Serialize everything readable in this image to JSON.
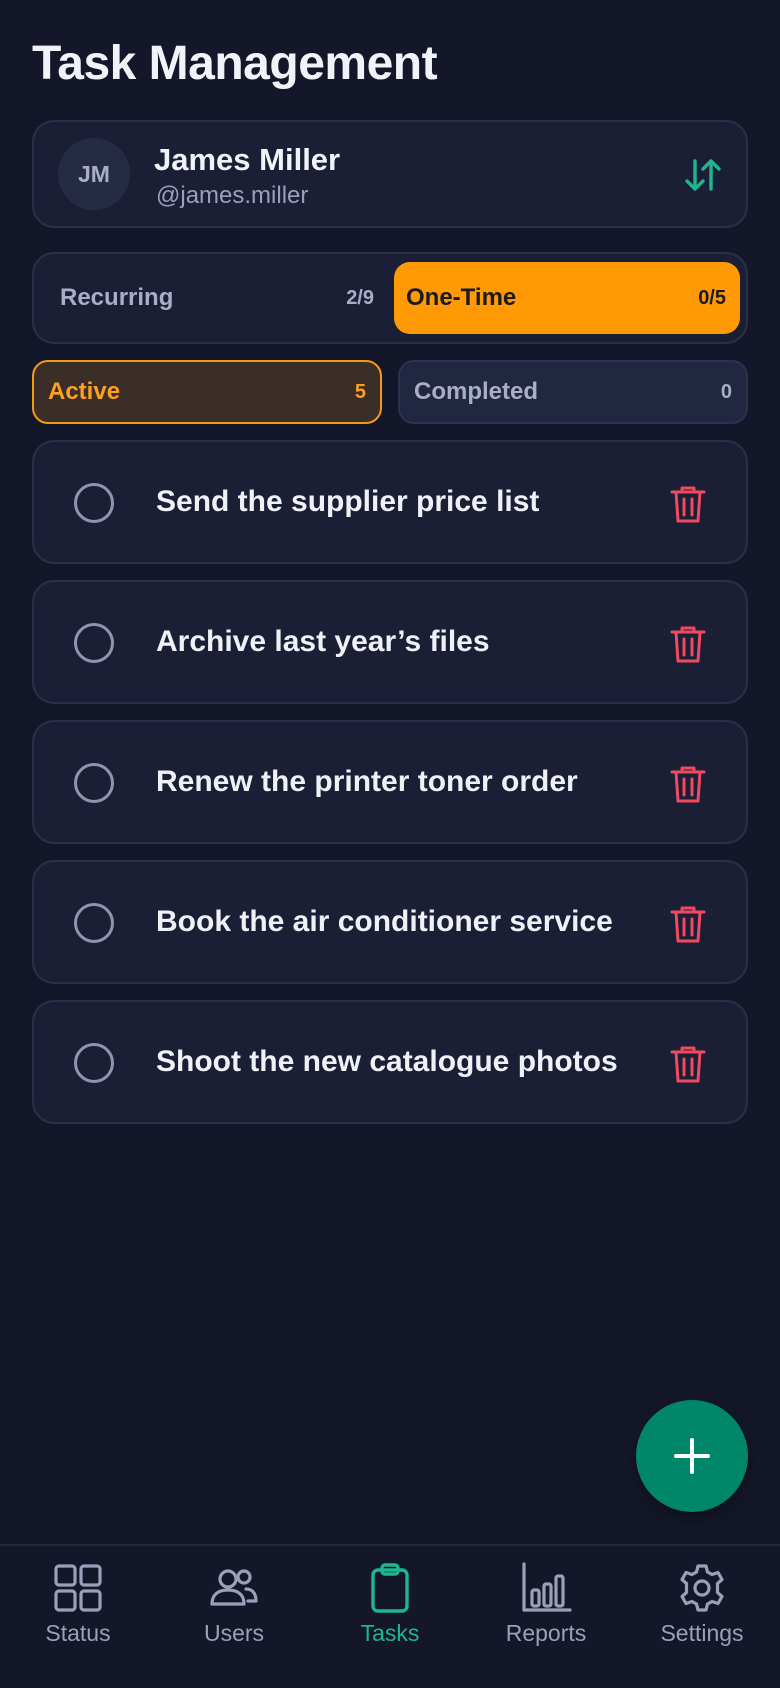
{
  "header": {
    "title": "Task Management"
  },
  "user": {
    "initials": "JM",
    "name": "James Miller",
    "handle": "@james.miller"
  },
  "segments": [
    {
      "label": "Recurring",
      "count": "2/9",
      "selected": false
    },
    {
      "label": "One-Time",
      "count": "0/5",
      "selected": true
    }
  ],
  "filters": [
    {
      "label": "Active",
      "count": "5",
      "selected": true
    },
    {
      "label": "Completed",
      "count": "0",
      "selected": false
    }
  ],
  "tasks": [
    {
      "text": "Send the supplier price list",
      "done": false
    },
    {
      "text": "Archive last year’s files",
      "done": false
    },
    {
      "text": "Renew the printer toner order",
      "done": false
    },
    {
      "text": "Book the air conditioner service",
      "done": false
    },
    {
      "text": "Shoot the new catalogue photos",
      "done": false
    }
  ],
  "nav": [
    {
      "label": "Status",
      "icon": "grid-icon"
    },
    {
      "label": "Users",
      "icon": "users-icon"
    },
    {
      "label": "Tasks",
      "icon": "clipboard-icon",
      "selected": true
    },
    {
      "label": "Reports",
      "icon": "bar-chart-icon"
    },
    {
      "label": "Settings",
      "icon": "gear-icon"
    }
  ],
  "colors": {
    "background": "#141729",
    "card": "#1B1F35",
    "accent_orange": "#FF9A05",
    "accent_green": "#1FB58E",
    "fab": "#00876A",
    "delete_red": "#EF4A5F"
  }
}
